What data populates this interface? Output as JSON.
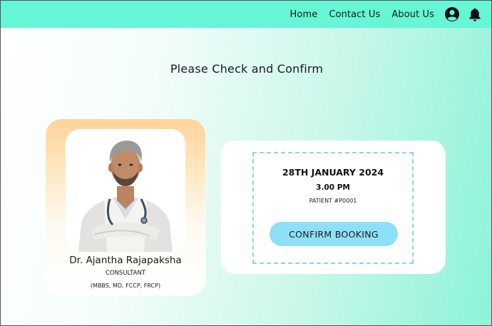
{
  "nav": {
    "links": [
      "Home",
      "Contact Us",
      "About Us"
    ],
    "icons": [
      "user-account-icon",
      "notification-bell-icon"
    ]
  },
  "page": {
    "title": "Please Check and Confirm"
  },
  "doctor": {
    "name": "Dr. Ajantha Rajapaksha",
    "role": "CONSULTANT",
    "qualifications": "(MBBS, MD, FCCP, FRCP)"
  },
  "booking": {
    "date": "28TH JANUARY 2024",
    "time": "3.00 PM",
    "patient": "PATIENT #P0001",
    "confirm_label": "CONFIRM BOOKING"
  },
  "colors": {
    "navbar": "#66f5d5",
    "confirm_button": "#8ee0f7",
    "dashed_border": "#8fd3ee",
    "card_gradient_top": "#ffd39b"
  }
}
